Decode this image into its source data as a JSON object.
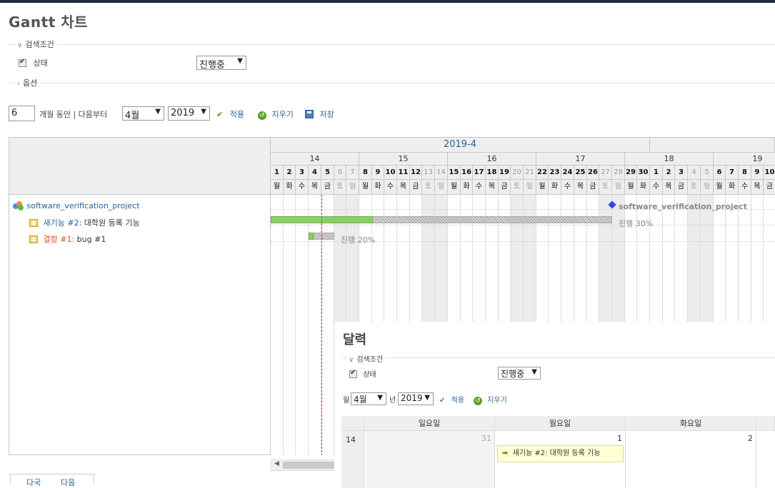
{
  "page": {
    "title": "Gantt 차트"
  },
  "filters": {
    "legend": "검색조건",
    "status_label": "상태",
    "status_value": "진행중",
    "options_legend": "옵션"
  },
  "controls": {
    "months_value": "6",
    "months_label": "개월 동안 | 다음부터",
    "month_select": "4월",
    "year_select": "2019",
    "apply_label": "적용",
    "clear_label": "지우기",
    "save_label": "저장"
  },
  "gantt": {
    "month_header": "2019-4",
    "weeks": [
      "14",
      "15",
      "16",
      "17",
      "18",
      "19"
    ],
    "day_numbers": [
      "1",
      "2",
      "3",
      "4",
      "5",
      "6",
      "7",
      "8",
      "9",
      "10",
      "11",
      "12",
      "13",
      "14",
      "15",
      "16",
      "17",
      "18",
      "19",
      "20",
      "21",
      "22",
      "23",
      "24",
      "25",
      "26",
      "27",
      "28",
      "29",
      "30",
      "1",
      "2",
      "3",
      "4",
      "5",
      "6",
      "7",
      "8",
      "9",
      "10"
    ],
    "day_of_week": [
      "월",
      "화",
      "수",
      "목",
      "금",
      "토",
      "일",
      "월",
      "화",
      "수",
      "목",
      "금",
      "토",
      "일",
      "월",
      "화",
      "수",
      "목",
      "금",
      "토",
      "일",
      "월",
      "화",
      "수",
      "목",
      "금",
      "토",
      "일",
      "월",
      "화",
      "수",
      "목",
      "금",
      "토",
      "일",
      "월",
      "화",
      "수",
      "목",
      "금"
    ],
    "tree": [
      {
        "label": "software_verification_project",
        "kind": "project"
      },
      {
        "tracker": "새기능 #2:",
        "subject": "대학원 등록 기능",
        "kind": "feature"
      },
      {
        "tracker": "결함 #1:",
        "subject": "bug #1",
        "kind": "bug"
      }
    ],
    "project_bar_label": "software_verification_project",
    "feature_progress_label": "진행 30%",
    "feature_progress": 0.3,
    "bug_progress_label": "진행 20%",
    "bug_progress": 0.2
  },
  "calendar": {
    "title": "달력",
    "legend": "검색조건",
    "status_label": "상태",
    "status_value": "진행중",
    "month_prefix": "월",
    "month_select": "4월",
    "year_prefix": "년",
    "year_select": "2019",
    "apply_label": "적용",
    "clear_label": "지우기",
    "headers": [
      "일요일",
      "월요일",
      "화요일"
    ],
    "week_number": "14",
    "days": [
      "31",
      "1",
      "2"
    ],
    "issue_label": "새기능 #2: 대학원 등록 기능"
  },
  "bottom_tabs": [
    "다국",
    "다음"
  ],
  "colors": {
    "link": "#2a5f95",
    "bug": "#d9541e",
    "progress_done": "#8ccc6e",
    "today_line": "#d0302a",
    "milestone": "#3344ee"
  }
}
